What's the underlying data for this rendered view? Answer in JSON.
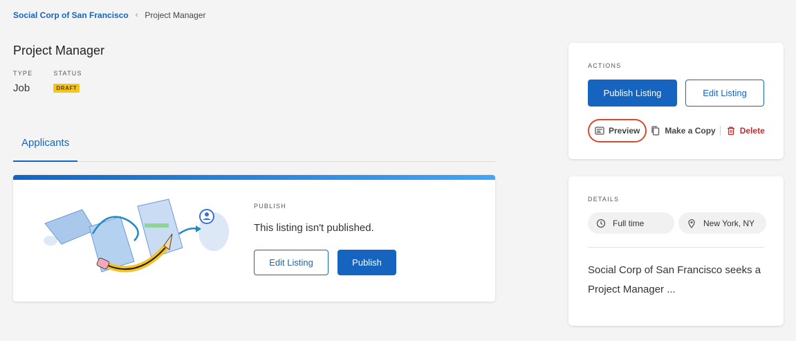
{
  "breadcrumb": {
    "parent": "Social Corp of San Francisco",
    "separator": "‹",
    "current": "Project Manager"
  },
  "header": {
    "title": "Project Manager",
    "type_label": "TYPE",
    "type_value": "Job",
    "status_label": "STATUS",
    "status_value": "DRAFT"
  },
  "tabs": [
    {
      "label": "Applicants",
      "active": true
    }
  ],
  "publish_panel": {
    "label": "PUBLISH",
    "message": "This listing isn't published.",
    "edit_button": "Edit Listing",
    "publish_button": "Publish"
  },
  "actions": {
    "label": "ACTIONS",
    "publish_button": "Publish Listing",
    "edit_button": "Edit Listing",
    "preview": "Preview",
    "copy": "Make a Copy",
    "delete": "Delete"
  },
  "details": {
    "label": "DETAILS",
    "employment": "Full time",
    "location": "New York, NY",
    "description": "Social Corp of San Francisco seeks a Project Manager ..."
  },
  "colors": {
    "accent": "#1565c0",
    "badge": "#f5c518",
    "danger": "#c62828",
    "highlight": "#d9472b"
  }
}
